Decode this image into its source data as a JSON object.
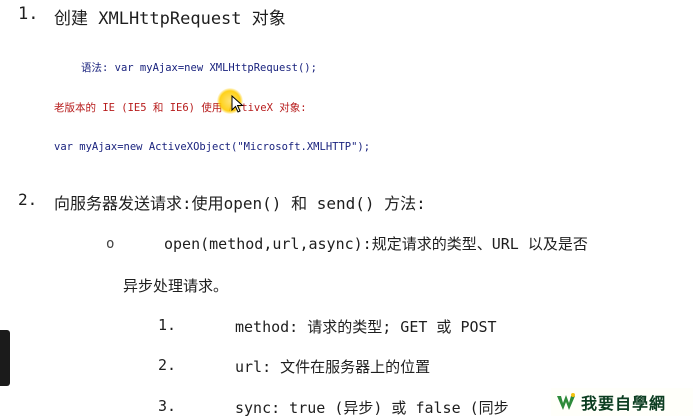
{
  "section1": {
    "number": "1.",
    "title": "创建 XMLHttpRequest 对象",
    "syntax_line": "语法: var myAjax=new XMLHttpRequest();",
    "note_line": "老版本的 IE (IE5 和 IE6) 使用 ActiveX 对象:",
    "code_line": "var myAjax=new ActiveXObject(\"Microsoft.XMLHTTP\");"
  },
  "section2": {
    "number": "2.",
    "title": "向服务器发送请求:使用open() 和 send() 方法:",
    "bullet": "o",
    "open_line_1": "open(method,url,async):规定请求的类型、URL 以及是否",
    "open_line_2": "异步处理请求。",
    "params": [
      {
        "num": "1.",
        "text": "method: 请求的类型; GET 或 POST"
      },
      {
        "num": "2.",
        "text": "url: 文件在服务器上的位置"
      },
      {
        "num": "3.",
        "text": "sync: true (异步) 或 false (同步"
      }
    ]
  },
  "watermark": {
    "text": "我要自學網"
  }
}
